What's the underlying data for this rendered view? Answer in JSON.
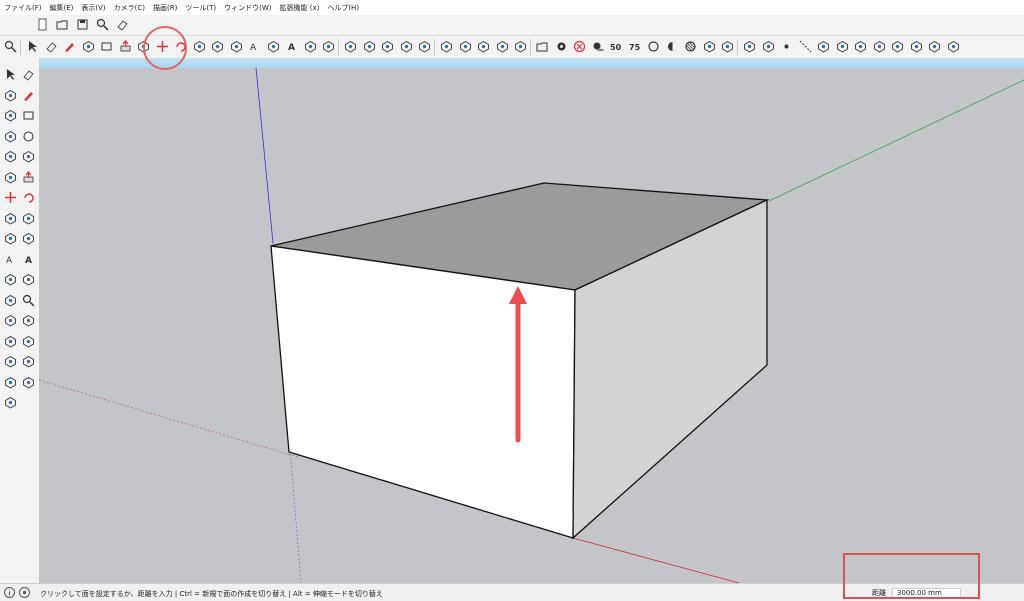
{
  "menu": [
    "ファイル(F)",
    "編集(E)",
    "表示(V)",
    "カメラ(C)",
    "描画(R)",
    "ツール(T)",
    "ウィンドウ(W)",
    "拡張機能 (x)",
    "ヘルプ(H)"
  ],
  "toolbar_top": [
    "new-file",
    "open-folder",
    "save",
    "search",
    "eraser"
  ],
  "toolbar_main": [
    "zoom",
    "select",
    "eraser",
    "pencil",
    "arc",
    "rectangle",
    "push-pull",
    "follow-me",
    "move",
    "rotate",
    "scale",
    "offset",
    "tape",
    "dimension",
    "protractor",
    "text",
    "orbit",
    "pan",
    "zoom-window",
    "zoom-extents",
    "add-location",
    "components",
    "materials",
    "styles",
    "camera-position",
    "walk",
    "look-around",
    "section",
    "open-folder",
    "settings",
    "close",
    "shadows",
    "fog-50",
    "fog-75",
    "xray",
    "wireframe",
    "hidden-line",
    "monochrome",
    "share",
    "upload",
    "download",
    "dot",
    "guide",
    "iso",
    "top",
    "front",
    "right",
    "back",
    "left",
    "cloud-upload",
    "cloud-download"
  ],
  "toolbar_left": [
    "select",
    "eraser",
    "paint",
    "line",
    "freehand",
    "rectangle",
    "rotated-rect",
    "circle",
    "polygon",
    "arc",
    "pie",
    "push-pull",
    "move",
    "rotate",
    "follow-me",
    "scale",
    "offset",
    "tape",
    "dimension",
    "text",
    "axes",
    "orbit",
    "pan",
    "zoom",
    "zoom-window",
    "zoom-extents",
    "previous",
    "walk",
    "look",
    "section",
    "section-fill",
    "component",
    "material"
  ],
  "status": {
    "hint": "クリックして面を設定するか、距離を入力 | Ctrl = 新規で面の作成を切り替え | Alt = 伸縮モードを切り替え",
    "measure_label": "距離",
    "measure_value": "3000.00 mm"
  },
  "colors": {
    "viewport_bg": "#c4c5cb",
    "top_face": "#9a9a9a",
    "front_face": "#ffffff",
    "side_face": "#d3d3d3",
    "highlight": "#e06666",
    "arrow": "#e8504f",
    "axis_red": "#c33",
    "axis_green": "#3a3",
    "axis_blue": "#33c"
  }
}
